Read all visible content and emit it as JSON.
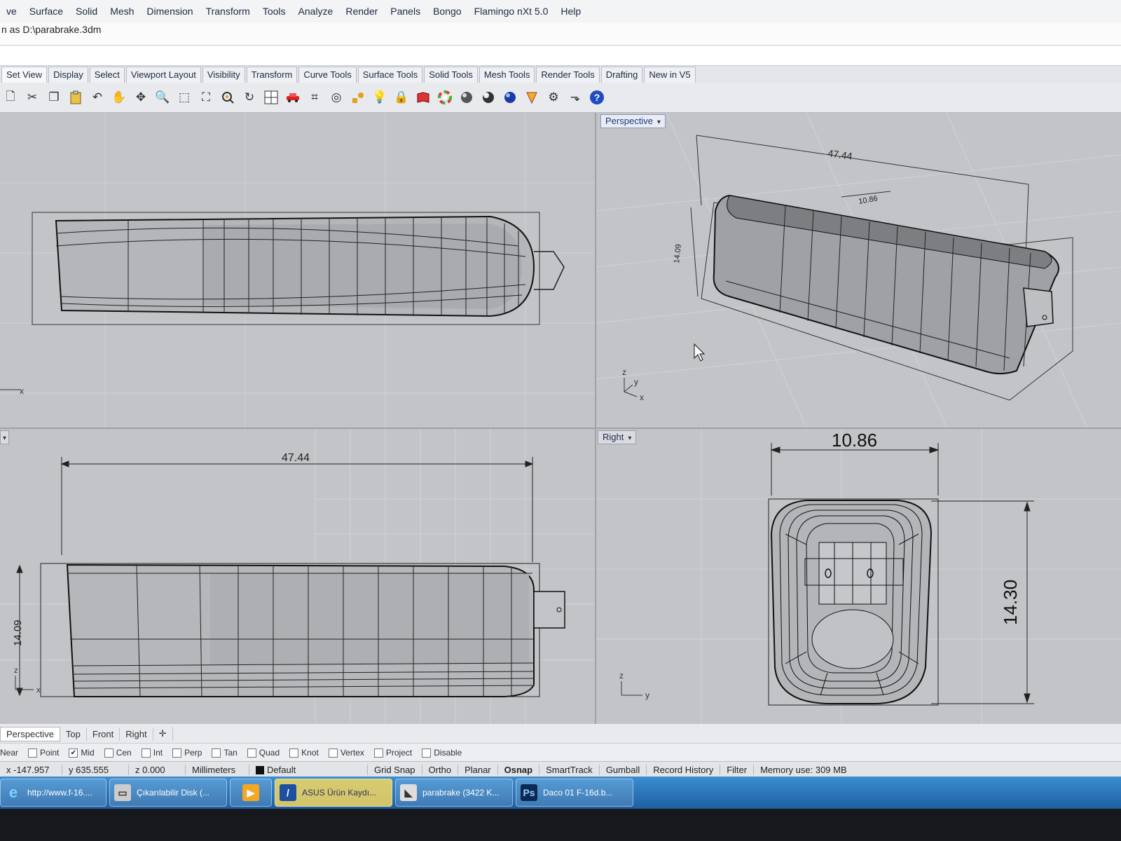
{
  "menu": [
    "ve",
    "Surface",
    "Solid",
    "Mesh",
    "Dimension",
    "Transform",
    "Tools",
    "Analyze",
    "Render",
    "Panels",
    "Bongo",
    "Flamingo nXt 5.0",
    "Help"
  ],
  "command_history": "n as D:\\parabrake.3dm",
  "toolbar_tabs": [
    "Set View",
    "Display",
    "Select",
    "Viewport Layout",
    "Visibility",
    "Transform",
    "Curve Tools",
    "Surface Tools",
    "Solid Tools",
    "Mesh Tools",
    "Render Tools",
    "Drafting",
    "New in V5"
  ],
  "toolbar_icons": [
    "new-icon",
    "cut-icon",
    "copy-icon",
    "paste-icon",
    "undo-icon",
    "pan-hand-icon",
    "rotate-view-icon",
    "zoom-icon",
    "zoom-window-icon",
    "zoom-extents-icon",
    "zoom-selected-icon",
    "rotate-icon",
    "four-viewports-icon",
    "car-icon",
    "grid-icon",
    "circle-icon",
    "points-icon",
    "light-icon",
    "lock-icon",
    "book-icon",
    "color-wheel-icon",
    "shade-sphere-icon",
    "render-sphere-icon",
    "blue-sphere-icon",
    "cone-icon",
    "gear-icon",
    "dimension-icon",
    "help-icon"
  ],
  "viewports": {
    "top": {
      "title": "",
      "axis_x": "x"
    },
    "perspective": {
      "title": "Perspective",
      "dim_length": "47.44",
      "dim_width": "10.86",
      "dim_height": "14.09",
      "axis_z": "z",
      "axis_y": "y",
      "axis_x": "x"
    },
    "front": {
      "title": "",
      "dim_length": "47.44",
      "dim_height": "14.09",
      "axis_z": "z",
      "axis_x": "x"
    },
    "right": {
      "title": "Right",
      "dim_width": "10.86",
      "dim_height": "14.30",
      "axis_z": "z",
      "axis_y": "y"
    }
  },
  "viewport_tabs": [
    "Perspective",
    "Top",
    "Front",
    "Right"
  ],
  "osnap": {
    "label": "Near",
    "items": [
      {
        "label": "Point",
        "checked": false
      },
      {
        "label": "Mid",
        "checked": true
      },
      {
        "label": "Cen",
        "checked": false
      },
      {
        "label": "Int",
        "checked": false
      },
      {
        "label": "Perp",
        "checked": false
      },
      {
        "label": "Tan",
        "checked": false
      },
      {
        "label": "Quad",
        "checked": false
      },
      {
        "label": "Knot",
        "checked": false
      },
      {
        "label": "Vertex",
        "checked": false
      },
      {
        "label": "Project",
        "checked": false
      },
      {
        "label": "Disable",
        "checked": false
      }
    ]
  },
  "status": {
    "x": "x -147.957",
    "y": "y 635.555",
    "z": "z 0.000",
    "units": "Millimeters",
    "layer": "Default",
    "grid_snap": "Grid Snap",
    "ortho": "Ortho",
    "planar": "Planar",
    "osnap": "Osnap",
    "smarttrack": "SmartTrack",
    "gumball": "Gumball",
    "record_history": "Record History",
    "filter": "Filter",
    "memory": "Memory use: 309 MB"
  },
  "taskbar": [
    {
      "label": "http://www.f-16....",
      "icon": "ie-icon",
      "active": false
    },
    {
      "label": "Çıkarılabilir Disk (...",
      "icon": "drive-icon",
      "active": false
    },
    {
      "label": "",
      "icon": "media-player-icon",
      "active": false
    },
    {
      "label": "ASUS Ürün Kaydı...",
      "icon": "asus-icon",
      "active": true
    },
    {
      "label": "parabrake (3422 K...",
      "icon": "rhino-icon",
      "active": false
    },
    {
      "label": "Daco 01 F-16d.b...",
      "icon": "photoshop-icon",
      "active": false
    }
  ],
  "colors": {
    "accent": "#1a3a7a",
    "viewport_bg": "#c2c4c8",
    "taskbar": "#2a74bd"
  }
}
